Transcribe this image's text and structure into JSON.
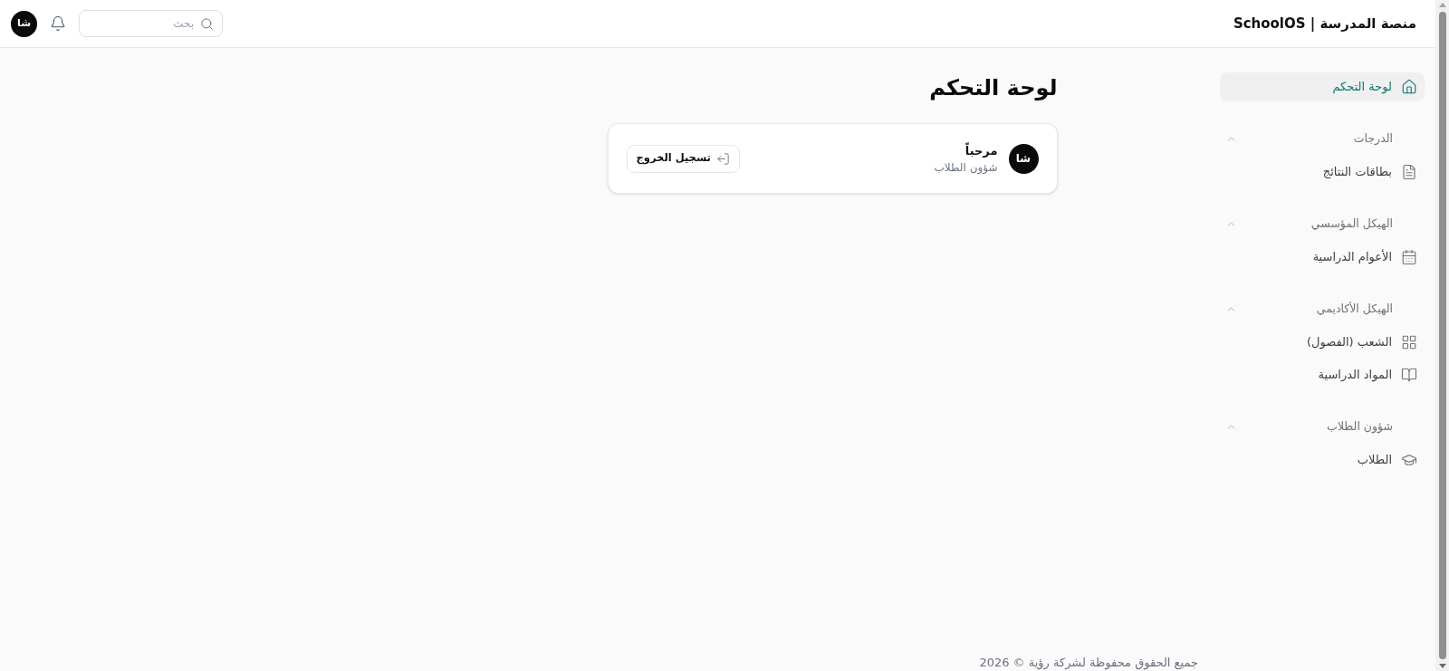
{
  "header": {
    "title": "منصة المدرسة | SchoolOS",
    "search": {
      "placeholder": "بحث"
    },
    "avatar": "شا"
  },
  "sidebar": {
    "items": [
      {
        "label": "لوحة التحكم",
        "selected": true
      }
    ],
    "sections": [
      {
        "title": "الدرجات",
        "expanded": true,
        "items": [
          {
            "label": "بطاقات النتائج",
            "selected": false
          }
        ]
      },
      {
        "title": "الهيكل المؤسسي",
        "expanded": true,
        "items": [
          {
            "label": "الأعوام الدراسية",
            "selected": false
          }
        ]
      },
      {
        "title": "الهيكل الأكاديمي",
        "expanded": true,
        "items": [
          {
            "label": "الشعب (الفصول)",
            "selected": false
          },
          {
            "label": "المواد الدراسية",
            "selected": false
          }
        ]
      },
      {
        "title": "شؤون الطلاب",
        "expanded": true,
        "items": [
          {
            "label": "الطلاب",
            "selected": false
          }
        ]
      }
    ]
  },
  "page_title": "لوحة التحكم",
  "welcome_card": {
    "avatar": "شا",
    "greeting": "مرحباً",
    "role": "شؤون الطلاب",
    "logout_button": "تسجيل الخروج"
  },
  "footer": {
    "copyright": "جميع الحقوق محفوظة لشركة رؤية © 2026"
  }
}
